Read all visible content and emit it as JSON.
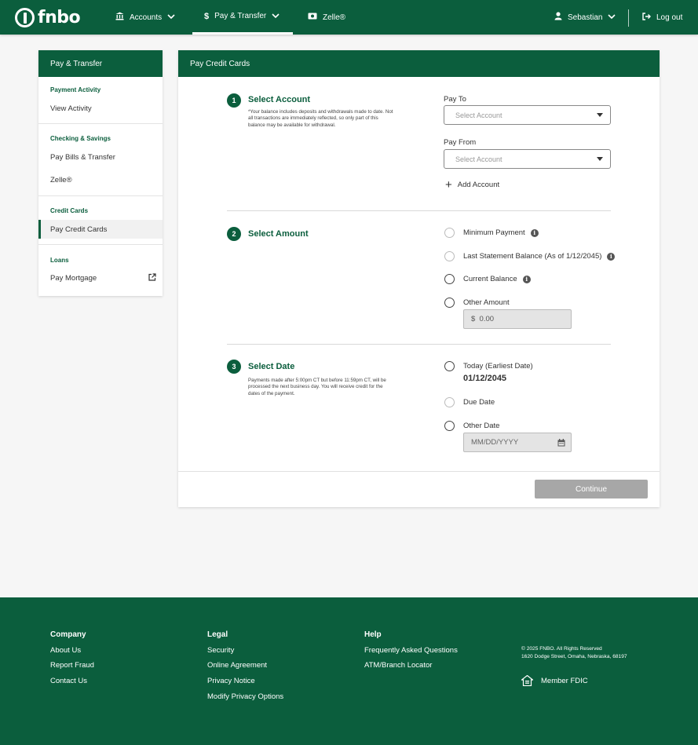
{
  "brand": {
    "name": "fnbo"
  },
  "nav": {
    "accounts": "Accounts",
    "pay_transfer": "Pay & Transfer",
    "zelle": "Zelle®",
    "user": "Sebastian",
    "logout": "Log out"
  },
  "sidebar": {
    "title": "Pay & Transfer",
    "sections": [
      {
        "title": "Payment Activity",
        "items": [
          "View Activity"
        ]
      },
      {
        "title": "Checking & Savings",
        "items": [
          "Pay Bills & Transfer",
          "Zelle®"
        ]
      },
      {
        "title": "Credit Cards",
        "items": [
          "Pay Credit Cards"
        ]
      },
      {
        "title": "Loans",
        "items": [
          "Pay Mortgage"
        ]
      }
    ]
  },
  "card": {
    "title": "Pay Credit Cards",
    "step1": {
      "num": "1",
      "title": "Select Account",
      "note": "*Your balance includes deposits and withdrawals made to date. Not all transactions are immediately reflected, so only part of this balance may be available for withdrawal.",
      "pay_to_label": "Pay To",
      "pay_to_placeholder": "Select Account",
      "pay_from_label": "Pay From",
      "pay_from_placeholder": "Select Account",
      "add_account": "Add Account"
    },
    "step2": {
      "num": "2",
      "title": "Select Amount",
      "options": [
        "Minimum Payment",
        "Last Statement Balance (As of 1/12/2045)",
        "Current Balance",
        "Other Amount"
      ],
      "amount_value": "$  0.00"
    },
    "step3": {
      "num": "3",
      "title": "Select Date",
      "note": "Payments made after 5:00pm CT but before 11:59pm CT, will be processed the next business day. You will receive credit for the dates of the payment.",
      "options": [
        "Today (Earliest Date)",
        "Due Date",
        "Other Date"
      ],
      "today_date": "01/12/2045",
      "date_placeholder": "MM/DD/YYYY"
    },
    "continue": "Continue"
  },
  "footer": {
    "company": {
      "title": "Company",
      "links": [
        "About Us",
        "Report Fraud",
        "Contact Us"
      ]
    },
    "legal": {
      "title": "Legal",
      "links": [
        "Security",
        "Online Agreement",
        "Privacy Notice",
        "Modify Privacy Options"
      ]
    },
    "help": {
      "title": "Help",
      "links": [
        "Frequently Asked Questions",
        "ATM/Branch Locator"
      ]
    },
    "copyright_line1": "© 2025 FNBO. All Rights Reserved",
    "copyright_line2": "1620 Dodge Street, Omaha, Nebraska, 68197",
    "fdic": "Member FDIC"
  }
}
